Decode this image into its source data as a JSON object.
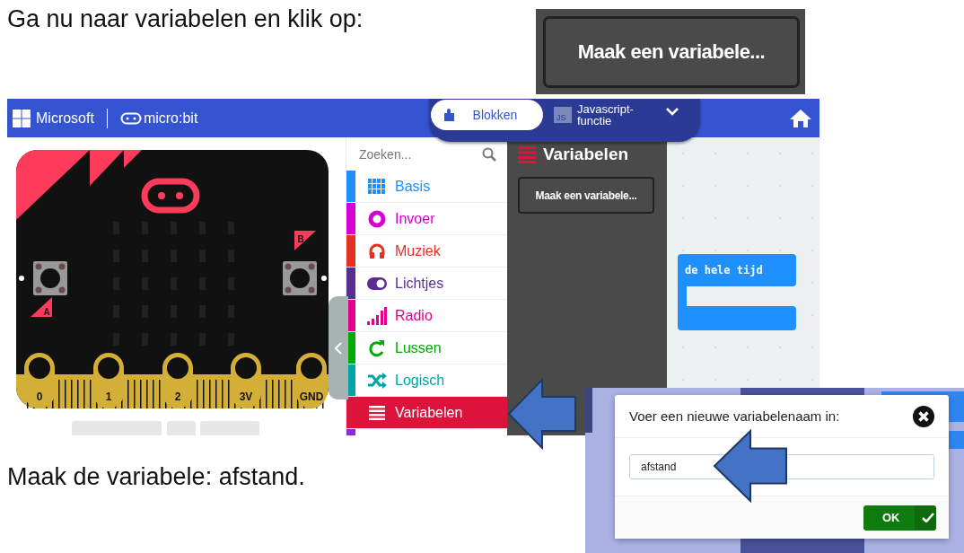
{
  "instructions": [
    {
      "text": "Ga nu naar variabelen en klik op:"
    },
    {
      "text": "Maak de variabele: afstand."
    }
  ],
  "button_crop": {
    "label": "Maak een variabele..."
  },
  "editor": {
    "brand": "Microsoft",
    "product": "micro:bit",
    "tabs": [
      {
        "label": "Blokken",
        "selected": true
      },
      {
        "label": "Javascript-functie",
        "badge": "JS",
        "selected": false
      }
    ],
    "simulator": {
      "buttons": [
        "A",
        "B"
      ],
      "pins": [
        "0",
        "1",
        "2",
        "3V",
        "GND"
      ]
    },
    "search": {
      "placeholder": "Zoeken..."
    },
    "categories": [
      {
        "label": "Basis",
        "color": "#1e90ff",
        "selected": false
      },
      {
        "label": "Invoer",
        "color": "#d400d4",
        "selected": false
      },
      {
        "label": "Muziek",
        "color": "#e63022",
        "selected": false
      },
      {
        "label": "Lichtjes",
        "color": "#5c2d91",
        "selected": false
      },
      {
        "label": "Radio",
        "color": "#e3008c",
        "selected": false
      },
      {
        "label": "Lussen",
        "color": "#00aa00",
        "selected": false
      },
      {
        "label": "Logisch",
        "color": "#00a4a6",
        "selected": false
      },
      {
        "label": "Variabelen",
        "color": "#dc143c",
        "selected": true
      }
    ],
    "flyout": {
      "title": "Variabelen",
      "button": "Maak een variabele..."
    },
    "block": {
      "label": "de hele tijd"
    }
  },
  "dialog": {
    "title": "Voer een nieuwe variabelenaam in:",
    "input": {
      "value": "afstand"
    },
    "ok": "OK"
  }
}
